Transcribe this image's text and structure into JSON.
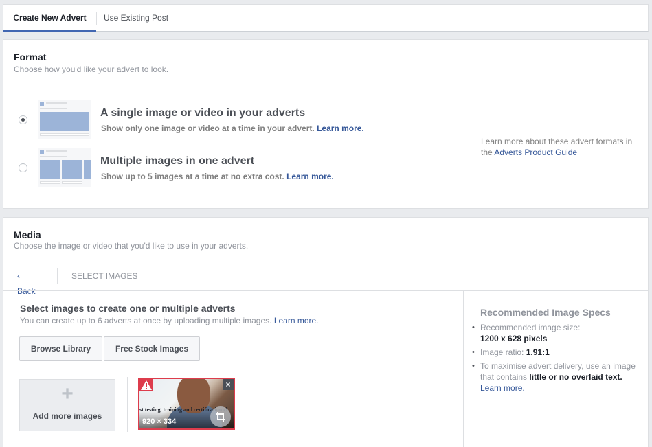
{
  "tabs": [
    {
      "label": "Create New Advert",
      "active": true
    },
    {
      "label": "Use Existing Post",
      "active": false
    }
  ],
  "format": {
    "title": "Format",
    "subtitle": "Choose how you'd like your advert to look.",
    "options": [
      {
        "title": "A single image or video in your adverts",
        "desc": "Show only one image or video at a time in your advert.",
        "link": "Learn more.",
        "selected": true
      },
      {
        "title": "Multiple images in one advert",
        "desc": "Show up to 5 images at a time at no extra cost.",
        "link": "Learn more.",
        "selected": false
      }
    ],
    "side_note_text": "Learn more about these advert formats in the",
    "side_note_link": "Adverts Product Guide"
  },
  "media": {
    "title": "Media",
    "subtitle": "Choose the image or video that you'd like to use in your adverts.",
    "back_label": "Back",
    "current_step": "SELECT IMAGES",
    "select_title": "Select images to create one or multiple adverts",
    "select_sub": "You can create up to 6 adverts at once by uploading multiple images.",
    "select_link": "Learn more.",
    "browse_label": "Browse Library",
    "stock_label": "Free Stock Images",
    "add_more_label": "Add more images",
    "image": {
      "overlay_text": "st testing, training and certification cl",
      "dimensions": "920 × 334"
    }
  },
  "specs": {
    "title": "Recommended Image Specs",
    "size_label": "Recommended image size:",
    "size_value": "1200 x 628 pixels",
    "ratio_label": "Image ratio:",
    "ratio_value": "1.91:1",
    "tip_pre": "To maximise advert delivery, use an image that contains",
    "tip_bold": "little or no overlaid text.",
    "tip_link": "Learn more."
  },
  "colors": {
    "accent": "#4267b2",
    "link": "#365899",
    "warning": "#dd3c4c"
  }
}
